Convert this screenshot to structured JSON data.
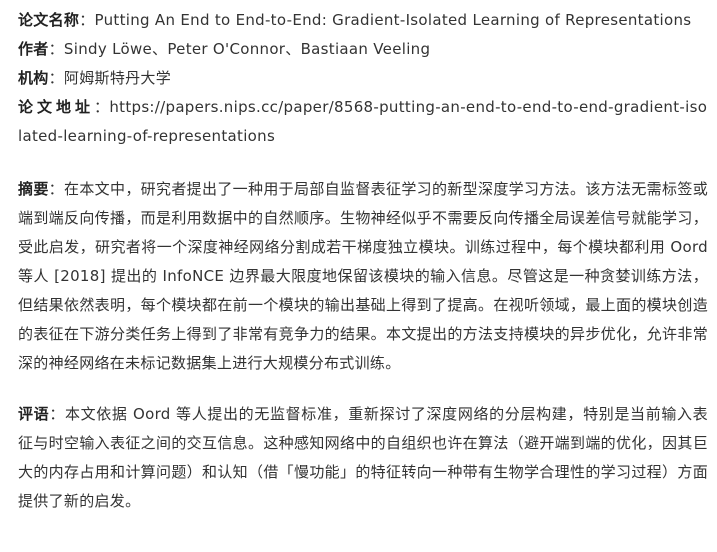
{
  "meta": {
    "title_label": "论文名称",
    "title_value": "Putting An End to End-to-End: Gradient-Isolated Learning of Representations",
    "authors_label": "作者",
    "authors_value": "Sindy Löwe、Peter O'Connor、Bastiaan Veeling",
    "institution_label": "机构",
    "institution_value": "阿姆斯特丹大学",
    "url_label": "论文地址",
    "url_value": "https://papers.nips.cc/paper/8568-putting-an-end-to-end-to-end-gradient-isolated-learning-of-representations"
  },
  "abstract": {
    "label": "摘要",
    "text": "在本文中，研究者提出了一种用于局部自监督表征学习的新型深度学习方法。该方法无需标签或端到端反向传播，而是利用数据中的自然顺序。生物神经似乎不需要反向传播全局误差信号就能学习，受此启发，研究者将一个深度神经网络分割成若干梯度独立模块。训练过程中，每个模块都利用 Oord 等人 [2018] 提出的 InfoNCE 边界最大限度地保留该模块的输入信息。尽管这是一种贪婪训练方法，但结果依然表明，每个模块都在前一个模块的输出基础上得到了提高。在视听领域，最上面的模块创造的表征在下游分类任务上得到了非常有竞争力的结果。本文提出的方法支持模块的异步优化，允许非常深的神经网络在未标记数据集上进行大规模分布式训练。"
  },
  "review": {
    "label": "评语",
    "text": "本文依据 Oord 等人提出的无监督标准，重新探讨了深度网络的分层构建，特别是当前输入表征与时空输入表征之间的交互信息。这种感知网络中的自组织也许在算法（避开端到端的优化，因其巨大的内存占用和计算问题）和认知（借「慢功能」的特征转向一种带有生物学合理性的学习过程）方面提供了新的启发。"
  },
  "separator": "："
}
